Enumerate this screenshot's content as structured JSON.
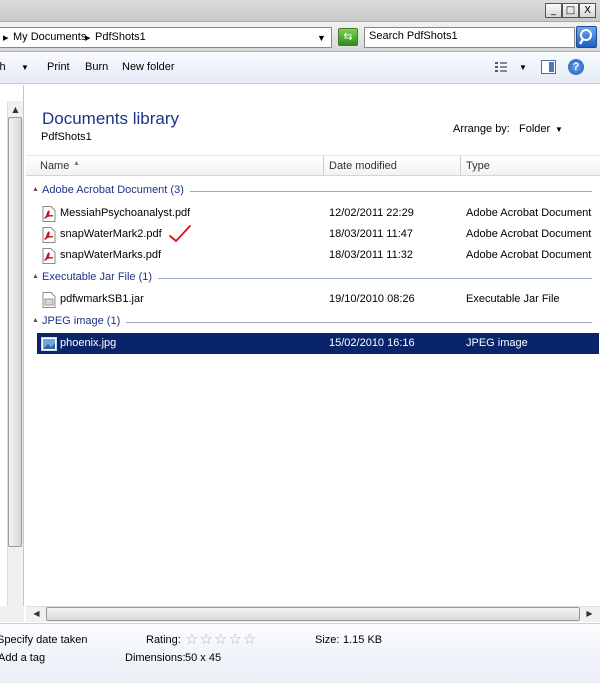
{
  "window": {
    "min": "_",
    "max": "□",
    "close": "X"
  },
  "address": {
    "crumbs": [
      "My Documents",
      "PdfShots1"
    ],
    "separator": "▸",
    "dropdown": "▼",
    "refresh": "⇆"
  },
  "search": {
    "placeholder": "Search PdfShots1"
  },
  "toolbar": {
    "open_with": "ith",
    "print": "Print",
    "burn": "Burn",
    "new_folder": "New folder",
    "arrow": "▼"
  },
  "library": {
    "title": "Documents library",
    "subtitle": "PdfShots1",
    "arrange_label": "Arrange by:",
    "arrange_value": "Folder"
  },
  "columns": {
    "name": "Name",
    "date": "Date modified",
    "type": "Type",
    "sort": "▲"
  },
  "groups": [
    {
      "label": "Adobe Acrobat Document (3)",
      "files": [
        {
          "name": "MessiahPsychoanalyst.pdf",
          "date": "12/02/2011 22:29",
          "type": "Adobe Acrobat Document",
          "icon": "pdf-icon"
        },
        {
          "name": "snapWaterMark2.pdf",
          "date": "18/03/2011 11:47",
          "type": "Adobe Acrobat Document",
          "icon": "pdf-icon"
        },
        {
          "name": "snapWaterMarks.pdf",
          "date": "18/03/2011 11:32",
          "type": "Adobe Acrobat Document",
          "icon": "pdf-icon"
        }
      ]
    },
    {
      "label": "Executable Jar File (1)",
      "files": [
        {
          "name": "pdfwmarkSB1.jar",
          "date": "19/10/2010 08:26",
          "type": "Executable Jar File",
          "icon": "jar-icon"
        }
      ]
    },
    {
      "label": "JPEG image (1)",
      "files": [
        {
          "name": "phoenix.jpg",
          "date": "15/02/2010 16:16",
          "type": "JPEG image",
          "icon": "image-icon",
          "selected": true
        }
      ]
    }
  ],
  "details": {
    "date_taken": "Specify date taken",
    "tag": "Add a tag",
    "rating_label": "Rating:",
    "rating_value": 0,
    "rating_max": 5,
    "dimensions_label": "Dimensions:",
    "dimensions_value": "50 x 45",
    "size_label": "Size:",
    "size_value": "1.15 KB"
  },
  "colors": {
    "selection": "#0a246a",
    "group_label": "#1e3287",
    "check_mark": "#e01010"
  }
}
